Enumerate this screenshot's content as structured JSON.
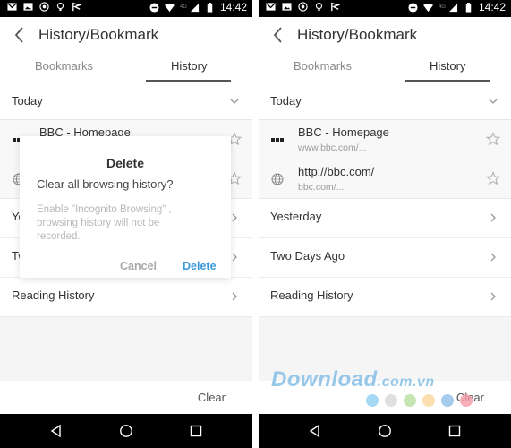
{
  "status_bar": {
    "time": "14:42",
    "network": "4G",
    "left_icons": [
      "gmail-icon",
      "gallery-icon",
      "whatsapp-icon",
      "lightbulb-icon",
      "flag-icon"
    ],
    "right_icons": [
      "do-not-disturb-icon",
      "wifi-icon",
      "signal-icon",
      "battery-icon"
    ]
  },
  "app_bar": {
    "title": "History/Bookmark",
    "back_icon": "chevron-left-icon"
  },
  "tabs": [
    {
      "label": "Bookmarks",
      "active": false
    },
    {
      "label": "History",
      "active": true
    }
  ],
  "history": {
    "today_label": "Today",
    "items": [
      {
        "title": "BBC - Homepage",
        "url": "www.bbc.com/...",
        "icon": "bbc-favicon",
        "starred": false
      },
      {
        "title": "http://bbc.com/",
        "url": "bbc.com/...",
        "icon": "globe-icon",
        "starred": false
      }
    ],
    "groups": [
      {
        "label": "Yesterday"
      },
      {
        "label": "Two Days Ago"
      },
      {
        "label": "Reading History"
      }
    ]
  },
  "bottom_bar": {
    "clear_label": "Clear"
  },
  "dialog": {
    "title": "Delete",
    "message": "Clear all browsing history?",
    "note": "Enable \"Incognito Browsing\" , browsing history will not be recorded.",
    "cancel_label": "Cancel",
    "confirm_label": "Delete",
    "accent_color": "#3a9ad9"
  },
  "watermark": {
    "text_main": "Download",
    "text_suffix": ".com.vn",
    "dot_colors": [
      "#8fd0f0",
      "#d8d8d8",
      "#b6e0a0",
      "#fbd79a",
      "#8fbfe8",
      "#f59aa6"
    ]
  },
  "colors": {
    "active_tab_indicator": "#555555",
    "status_bar_bg": "#000000",
    "nav_bar_bg": "#000000",
    "page_bg": "#f5f5f5"
  }
}
